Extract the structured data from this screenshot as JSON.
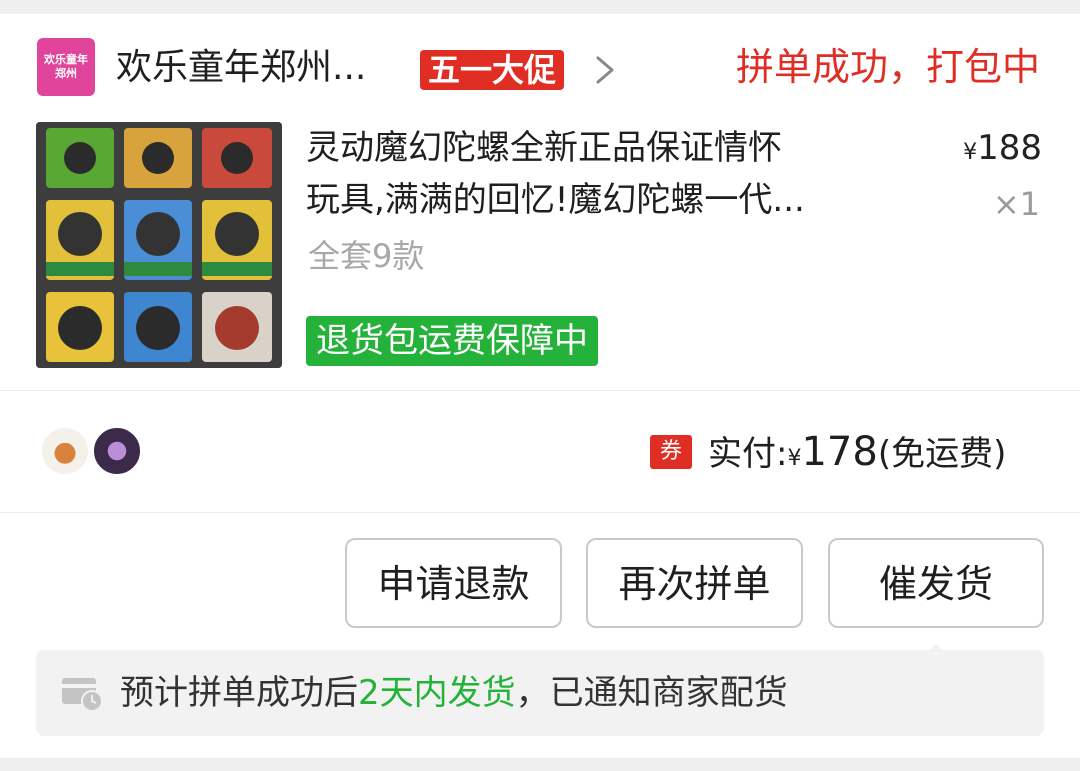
{
  "shop": {
    "logo_line1": "欢乐童年",
    "logo_line2": "郑州",
    "name": "欢乐童年郑州...",
    "promo_badge": "五一大促",
    "logo_color": "#e0459b"
  },
  "order": {
    "status": "拼单成功，打包中",
    "status_color": "#e02e24"
  },
  "product": {
    "title_line1": "灵动魔幻陀螺全新正品保证情怀",
    "title_line2": "玩具,满满的回忆!魔幻陀螺一代...",
    "price_symbol": "¥",
    "price": "188",
    "quantity": "×1",
    "sku": "全套9款",
    "guarantee": "退货包运费保障中",
    "guarantee_color": "#25b23a"
  },
  "payment": {
    "coupon_icon": "券",
    "label": "实付:",
    "symbol": "¥",
    "amount": "178",
    "note": "(免运费)"
  },
  "group_avatars": [
    "avatar-cartoon-icon",
    "avatar-anime-icon"
  ],
  "actions": {
    "refund": "申请退款",
    "regroup": "再次拼单",
    "urge": "催发货"
  },
  "tip": {
    "icon": "truck-clock-icon",
    "prefix": "预计拼单成功后",
    "highlight": "2天内发货",
    "suffix": "，已通知商家配货"
  }
}
